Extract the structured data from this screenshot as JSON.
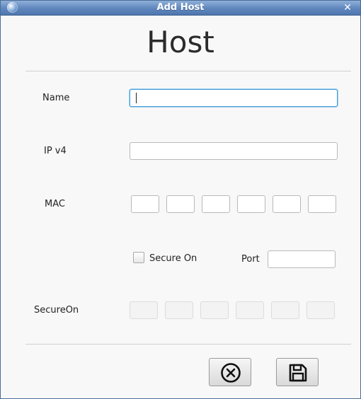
{
  "window": {
    "title": "Add Host",
    "app_icon": "globe-icon",
    "close_glyph": "✕"
  },
  "form": {
    "heading": "Host",
    "name_label": "Name",
    "name_value": "",
    "ipv4_label": "IP v4",
    "ipv4_value": "",
    "mac_label": "MAC",
    "mac_octets": [
      "",
      "",
      "",
      "",
      "",
      ""
    ],
    "secure_on_checkbox_label": "Secure On",
    "secure_on_checked": false,
    "port_label": "Port",
    "port_value": "",
    "secureon_label": "SecureOn",
    "secureon_octets": [
      "",
      "",
      "",
      "",
      "",
      ""
    ]
  },
  "buttons": {
    "cancel_icon": "cancel-circle-x-icon",
    "save_icon": "floppy-disk-icon"
  },
  "colors": {
    "titlebar": "#5f86bd",
    "focus_border": "#4a9fd5",
    "window_bg": "#f8f8f8"
  }
}
